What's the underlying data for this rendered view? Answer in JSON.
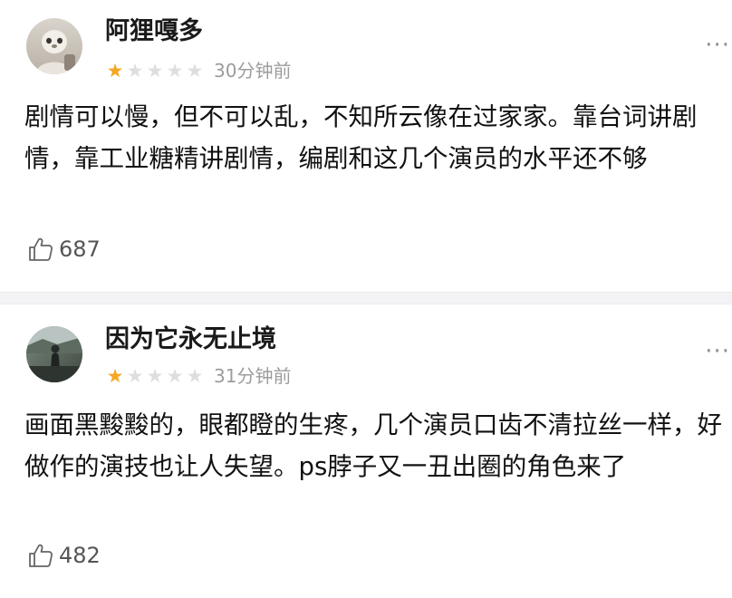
{
  "colors": {
    "star_filled": "#f5a623",
    "star_empty": "#dedede",
    "meta_text": "#9c9c9c"
  },
  "reviews": [
    {
      "username": "阿狸嘎多",
      "rating": 1,
      "rating_max": 5,
      "time": "30分钟前",
      "content": "剧情可以慢，但不可以乱，不知所云像在过家家。靠台词讲剧情，靠工业糖精讲剧情，编剧和这几个演员的水平还不够",
      "likes": "687",
      "avatar_icon": "user-avatar-icon",
      "more_label": "···"
    },
    {
      "username": "因为它永无止境",
      "rating": 1,
      "rating_max": 5,
      "time": "31分钟前",
      "content": "画面黑黢黢的，眼都瞪的生疼，几个演员口齿不清拉丝一样，好做作的演技也让人失望。ps脖子又一丑出圈的角色来了",
      "likes": "482",
      "avatar_icon": "user-avatar-icon",
      "more_label": "···"
    }
  ]
}
